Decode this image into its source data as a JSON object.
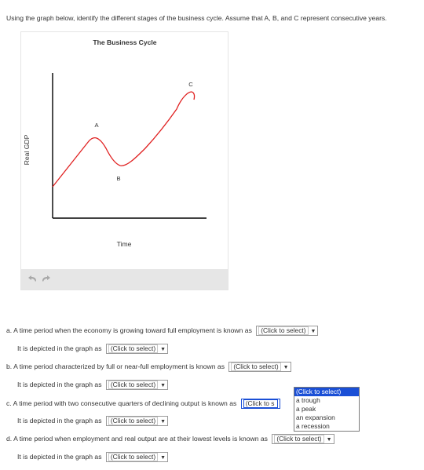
{
  "intro": "Using the graph below, identify the different stages of the business cycle. Assume that A, B, and C represent consecutive years.",
  "graph": {
    "title": "The Business Cycle",
    "y_label": "Real GDP",
    "x_label": "Time",
    "points": {
      "a": "A",
      "b": "B",
      "c": "C"
    },
    "curve_color": "#e02020"
  },
  "toolbar": {
    "undo_icon": "undo-icon",
    "redo_icon": "redo-icon"
  },
  "questions": {
    "a": {
      "text": "a. A time period when the economy is growing toward full employment is known as",
      "select": "(Click to select)",
      "depicted": "It is depicted in the graph as",
      "depicted_select": "(Click to select)"
    },
    "b": {
      "text": "b. A time period characterized by full or near-full employment is known as",
      "select": "(Click to select)",
      "depicted": "It is depicted in the graph as",
      "depicted_select": "(Click to select)"
    },
    "c": {
      "text": "c. A time period with two consecutive quarters of declining output is known as",
      "select": "(Click to s",
      "depicted": "It is depicted in the graph as",
      "depicted_select": "(Click to select)"
    },
    "d": {
      "text": "d. A time period when employment and real output are at their lowest levels is known as",
      "select": "(Click to select)",
      "depicted": "It is depicted in the graph as",
      "depicted_select": "(Click to select)"
    }
  },
  "open_dropdown": {
    "options": [
      "(Click to select)",
      "a trough",
      "a peak",
      "an expansion",
      "a recession"
    ],
    "selected": "(Click to select)"
  },
  "colors": {
    "accent": "#1a4fd6",
    "toolbar_bg": "#e6e6e6"
  }
}
